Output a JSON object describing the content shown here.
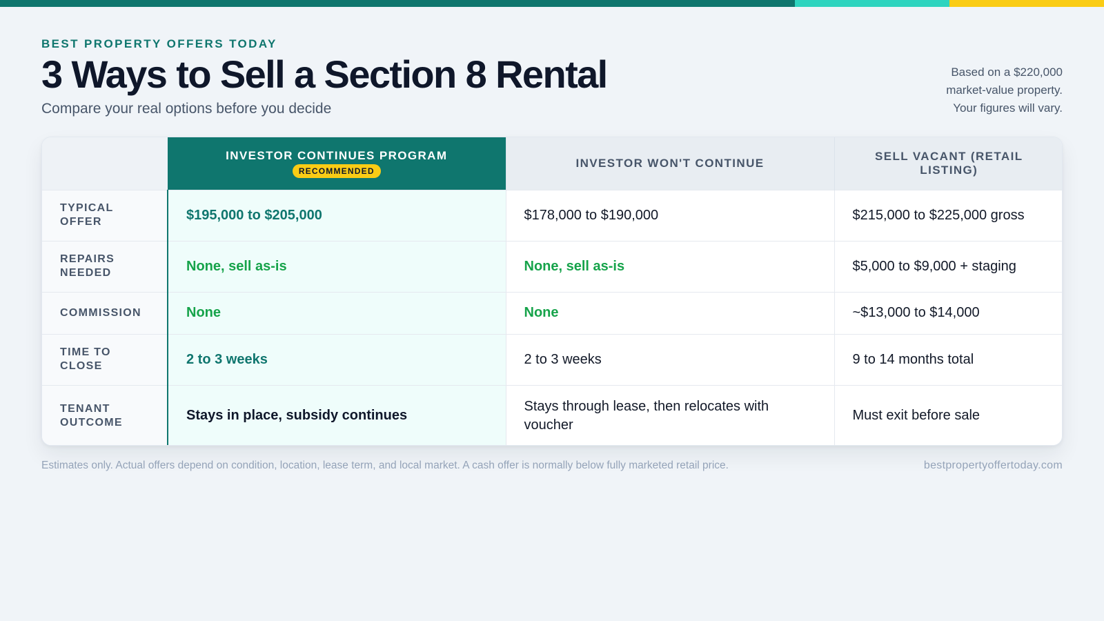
{
  "header": {
    "eyebrow": "BEST PROPERTY OFFERS TODAY",
    "title": "3 Ways to Sell a Section 8 Rental",
    "subtitle": "Compare your real options before you decide",
    "note_lines": [
      "Based on a $220,000",
      "market-value property.",
      "Your figures will vary."
    ]
  },
  "table": {
    "columns": [
      {
        "label": "INVESTOR CONTINUES PROGRAM",
        "badge": "RECOMMENDED"
      },
      {
        "label": "INVESTOR WON'T CONTINUE"
      },
      {
        "label": "SELL VACANT (RETAIL LISTING)"
      }
    ],
    "rows": [
      {
        "label": "TYPICAL OFFER",
        "cells": [
          "$195,000 to $205,000",
          "$178,000 to $190,000",
          "$215,000 to $225,000 gross"
        ]
      },
      {
        "label": "REPAIRS NEEDED",
        "cells": [
          "None, sell as-is",
          "None, sell as-is",
          "$5,000 to $9,000 + staging"
        ]
      },
      {
        "label": "COMMISSION",
        "cells": [
          "None",
          "None",
          "~$13,000 to $14,000"
        ]
      },
      {
        "label": "TIME TO CLOSE",
        "cells": [
          "2 to 3 weeks",
          "2 to 3 weeks",
          "9 to 14 months total"
        ]
      },
      {
        "label": "TENANT OUTCOME",
        "cells": [
          "Stays in place, subsidy continues",
          "Stays through lease, then relocates with voucher",
          "Must exit before sale"
        ]
      }
    ]
  },
  "footer": {
    "disclaimer": "Estimates only. Actual offers depend on condition, location, lease term, and local market. A cash offer is normally below fully marketed retail price.",
    "site": "bestpropertyoffertoday.com"
  },
  "colors": {
    "brand_teal": "#0f766e",
    "accent_aqua": "#2dd4bf",
    "accent_yellow": "#facc15",
    "positive_green": "#16a34a"
  }
}
